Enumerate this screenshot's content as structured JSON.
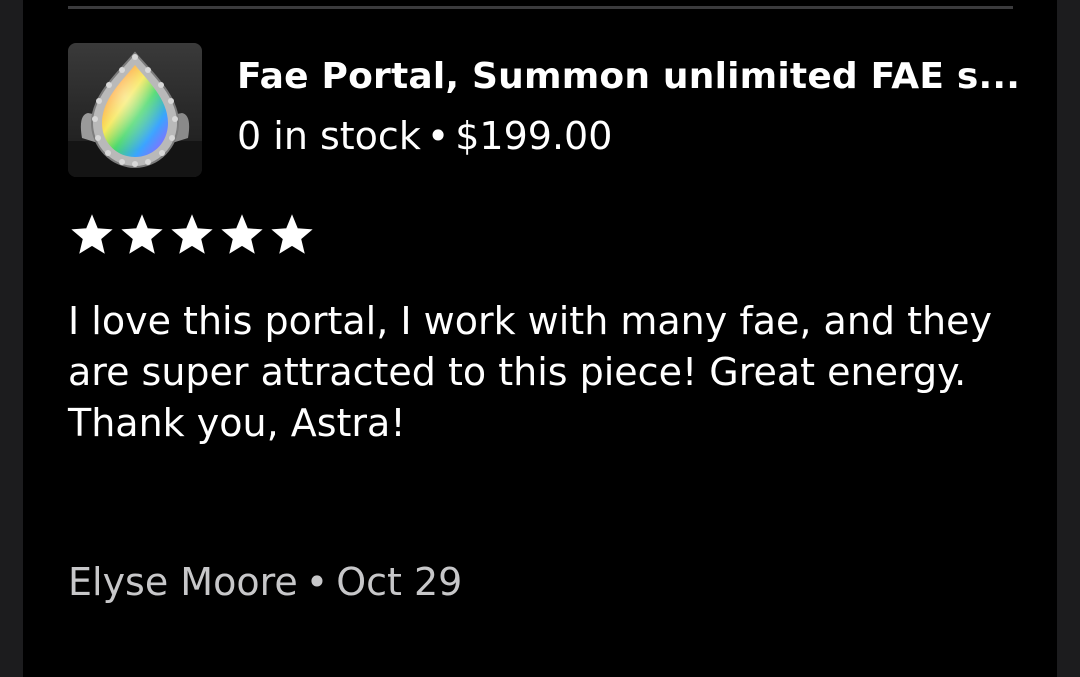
{
  "review": {
    "product": {
      "title": "Fae Portal, Summon unlimited FAE s...",
      "stock": "0 in stock",
      "separator": "•",
      "price": "$199.00",
      "thumbnail_icon": "rainbow-teardrop-ring-photo"
    },
    "rating": {
      "stars": 5,
      "max": 5,
      "star_color": "#ffffff"
    },
    "text": "I love this portal, I work with many fae, and they are super attracted to this piece! Great energy. Thank you, Astra!",
    "author": "Elyse Moore",
    "author_separator": "•",
    "date": "Oct 29"
  },
  "colors": {
    "background": "#000000",
    "outer": "#1c1c1e",
    "text_primary": "#ffffff",
    "text_secondary": "#c7c7c9",
    "divider": "#3b3b3d"
  }
}
